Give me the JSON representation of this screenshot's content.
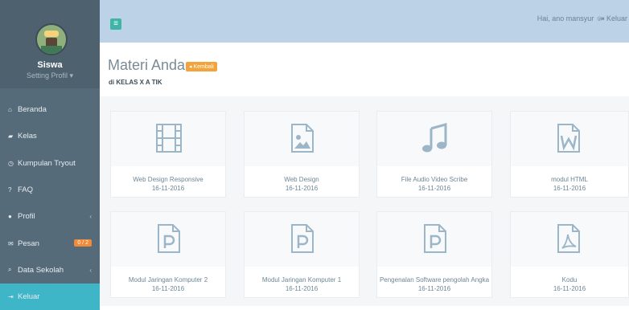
{
  "sidebar": {
    "user_name": "Siswa",
    "setting_label": "Setting Profil ▾",
    "items": [
      {
        "icon": "home-icon",
        "label": "Beranda"
      },
      {
        "icon": "graduation-cap-icon",
        "label": "Kelas"
      },
      {
        "icon": "clock-icon",
        "label": "Kumpulan Tryout"
      },
      {
        "icon": "question-icon",
        "label": "FAQ"
      },
      {
        "icon": "user-icon",
        "label": "Profil",
        "has_arrow": true
      },
      {
        "icon": "envelope-icon",
        "label": "Pesan",
        "badge": "0 / 2"
      },
      {
        "icon": "search-icon",
        "label": "Data Sekolah",
        "has_arrow": true
      },
      {
        "icon": "logout-icon",
        "label": "Keluar",
        "active": true
      }
    ]
  },
  "header": {
    "toggle_icon": "menu-icon",
    "greeting": "Hai, ano mansyur ☺",
    "logout_label": "Keluar"
  },
  "page": {
    "title": "Materi Anda",
    "back_label": "Kembali",
    "subtitle": "di KELAS X A TIK"
  },
  "materials": [
    {
      "icon": "film-icon",
      "name": "Web Design Responsive",
      "date": "16-11-2016"
    },
    {
      "icon": "image-file-icon",
      "name": "Web Design",
      "date": "16-11-2016"
    },
    {
      "icon": "music-icon",
      "name": "File Audio Video Scribe",
      "date": "16-11-2016"
    },
    {
      "icon": "word-file-icon",
      "name": "modul HTML",
      "date": "16-11-2016"
    },
    {
      "icon": "powerpoint-file-icon",
      "name": "Modul Jaringan Komputer 2",
      "date": "16-11-2016"
    },
    {
      "icon": "powerpoint-file-icon",
      "name": "Modul Jaringan Komputer 1",
      "date": "16-11-2016"
    },
    {
      "icon": "powerpoint-file-icon",
      "name": "Pengenalan Software pengolah Angka",
      "date": "16-11-2016"
    },
    {
      "icon": "pdf-file-icon",
      "name": "Kodu",
      "date": "16-11-2016"
    }
  ],
  "colors": {
    "sidebar": "#566b7a",
    "topbar": "#bcd3e7",
    "accent": "#3fb5c8",
    "back_button": "#f2a33c",
    "icon": "#9cb6c8"
  }
}
